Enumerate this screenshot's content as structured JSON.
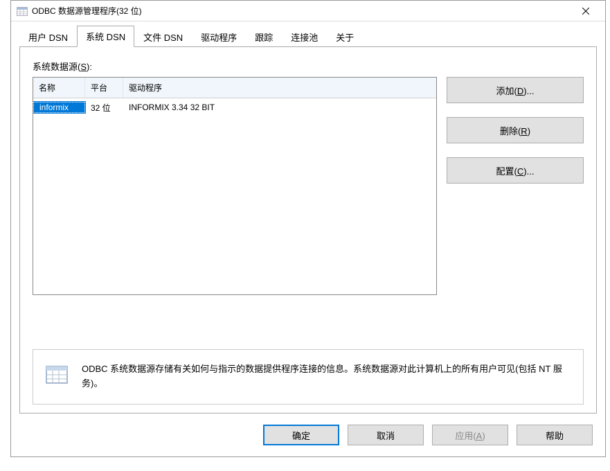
{
  "window": {
    "title": "ODBC 数据源管理程序(32 位)"
  },
  "tabs": [
    {
      "label": "用户 DSN"
    },
    {
      "label": "系统 DSN"
    },
    {
      "label": "文件 DSN"
    },
    {
      "label": "驱动程序"
    },
    {
      "label": "跟踪"
    },
    {
      "label": "连接池"
    },
    {
      "label": "关于"
    }
  ],
  "content": {
    "data_sources_label": "系统数据源(S):",
    "columns": {
      "name": "名称",
      "platform": "平台",
      "driver": "驱动程序"
    },
    "rows": [
      {
        "name": "informix",
        "platform": "32 位",
        "driver": "INFORMIX 3.34 32 BIT"
      }
    ],
    "buttons": {
      "add": "添加(D)...",
      "remove": "删除(R)",
      "configure": "配置(C)..."
    },
    "info": "ODBC 系统数据源存储有关如何与指示的数据提供程序连接的信息。系统数据源对此计算机上的所有用户可见(包括 NT 服务)。"
  },
  "footer": {
    "ok": "确定",
    "cancel": "取消",
    "apply": "应用(A)",
    "help": "帮助"
  }
}
